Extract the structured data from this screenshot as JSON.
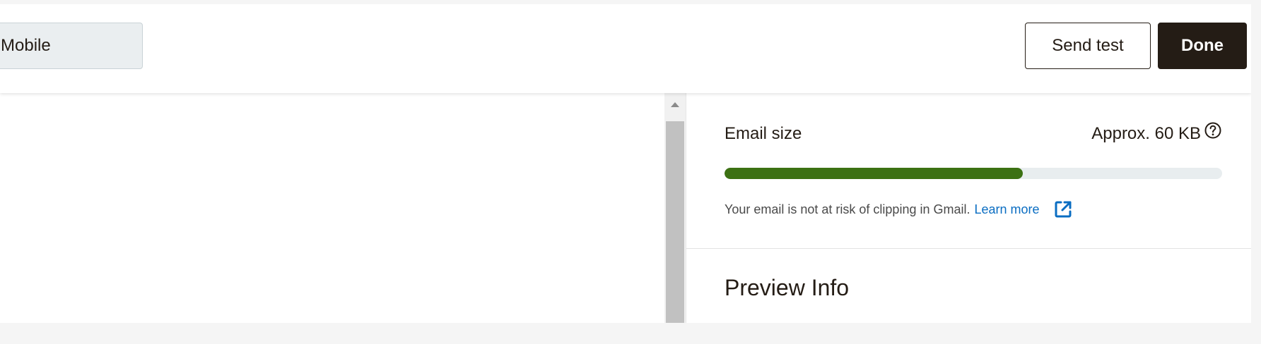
{
  "toolbar": {
    "view_toggle_label": "Mobile",
    "send_test_label": "Send test",
    "done_label": "Done"
  },
  "size_panel": {
    "label": "Email size",
    "value": "Approx. 60 KB",
    "help_icon": "question-circle-icon",
    "progress_fraction": 0.6,
    "progress_color": "#3c7113",
    "note": "Your email is not at risk of clipping in Gmail.",
    "learn_more_label": "Learn more",
    "external_link_icon": "external-link-icon"
  },
  "preview_info": {
    "heading": "Preview Info"
  },
  "colors": {
    "primary_button": "#241c15",
    "link": "#0a6dc2",
    "progress_track": "#e8edef"
  }
}
